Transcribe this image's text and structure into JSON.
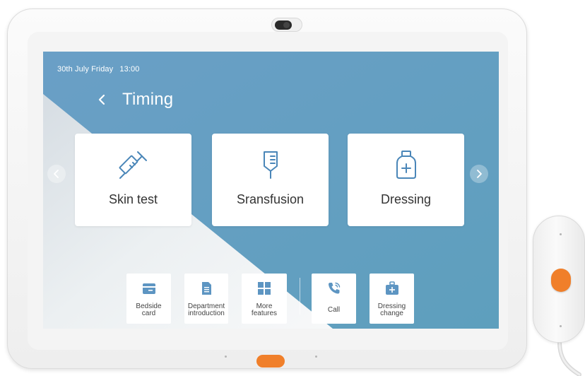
{
  "status": {
    "date": "30th July Friday",
    "time": "13:00"
  },
  "header": {
    "back_icon": "chevron-left-icon",
    "title": "Timing"
  },
  "cards": [
    {
      "label": "Skin test",
      "icon": "syringe-icon"
    },
    {
      "label": "Sransfusion",
      "icon": "iv-drip-icon"
    },
    {
      "label": "Dressing",
      "icon": "medicine-bottle-icon"
    }
  ],
  "carousel": {
    "prev_icon": "chevron-left-icon",
    "next_icon": "chevron-right-icon"
  },
  "dock": [
    {
      "line1": "Bedside",
      "line2": "card",
      "icon": "card-icon"
    },
    {
      "line1": "Department",
      "line2": "introduction",
      "icon": "document-icon"
    },
    {
      "line1": "More",
      "line2": "features",
      "icon": "grid-icon"
    },
    {
      "line1": "Call",
      "line2": "",
      "icon": "phone-icon"
    },
    {
      "line1": "Dressing",
      "line2": "change",
      "icon": "medical-kit-icon"
    }
  ],
  "colors": {
    "screen_blue": "#6aa8c2",
    "icon_blue": "#4a86b8",
    "accent_orange": "#f07f2a"
  }
}
